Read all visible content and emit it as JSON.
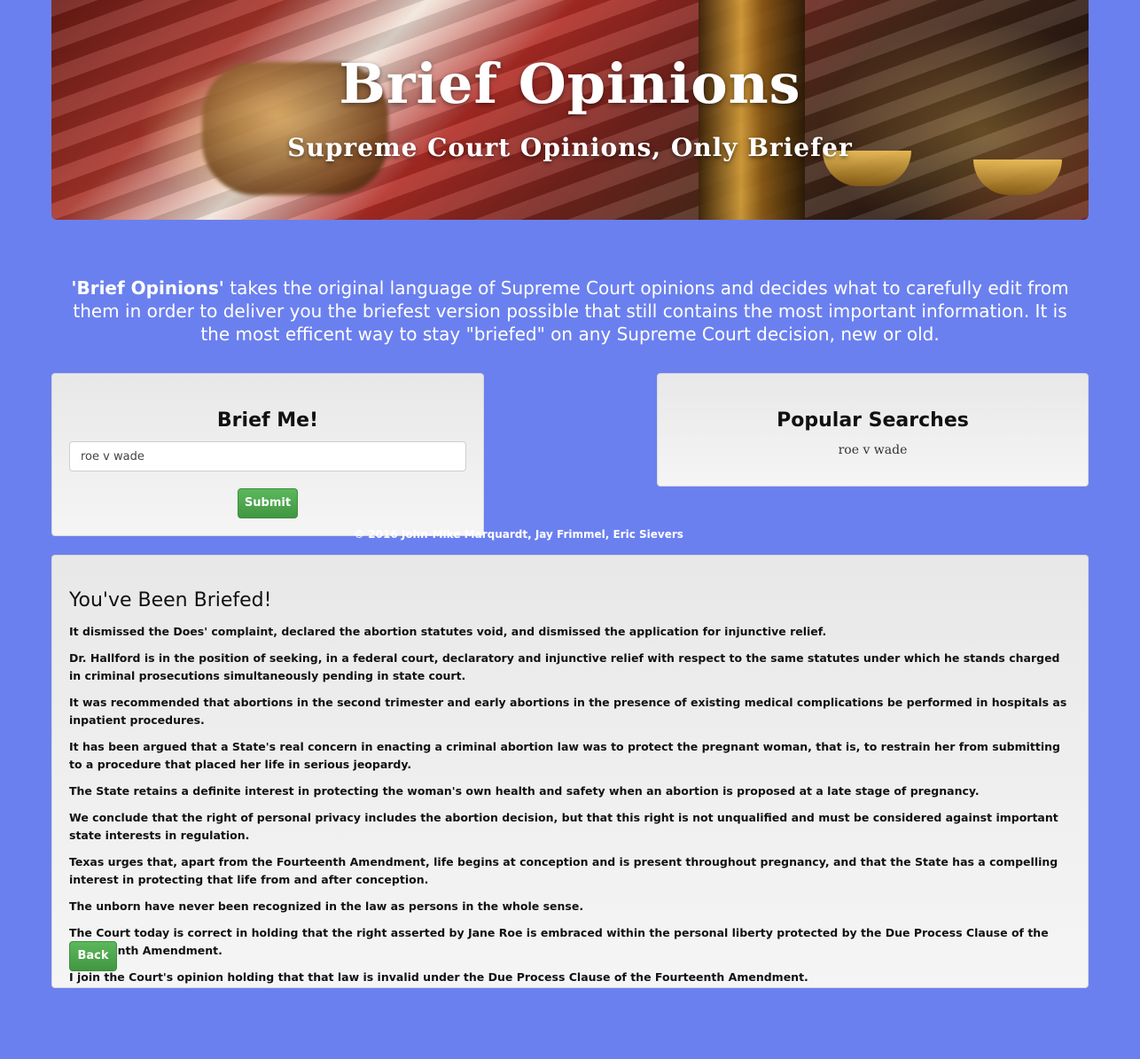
{
  "header": {
    "title": "Brief Opinions",
    "subtitle": "Supreme Court Opinions, Only Briefer"
  },
  "intro": {
    "brand": "'Brief Opinions'",
    "text": " takes the original language of Supreme Court opinions and decides what to carefully edit from them in order to deliver you the briefest version possible that still contains the most important information. It is the most efficent way to stay \"briefed\" on any Supreme Court decision, new or old."
  },
  "search": {
    "heading": "Brief Me!",
    "value": "roe v wade",
    "submit_label": "Submit"
  },
  "popular": {
    "heading": "Popular Searches",
    "items": [
      "roe v wade"
    ]
  },
  "footer": {
    "text": "© 2016 John-Mike Marquardt, Jay Frimmel, Eric Sievers"
  },
  "results": {
    "heading": "You've Been Briefed!",
    "sentences": [
      "It dismissed the Does' complaint, declared the abortion statutes void, and dismissed the application for injunctive relief.",
      "Dr. Hallford is in the position of seeking, in a federal court, declaratory and injunctive relief with respect to the same statutes under which he stands charged in criminal prosecutions simultaneously pending in state court.",
      "It was recommended that abortions in the second trimester and early abortions in the presence of existing medical complications be performed in hospitals as inpatient procedures.",
      "It has been argued that a State's real concern in enacting a criminal abortion law was to protect the pregnant woman, that is, to restrain her from submitting to a procedure that placed her life in serious jeopardy.",
      "The State retains a definite interest in protecting the woman's own health and safety when an abortion is proposed at a late stage of pregnancy.",
      "We conclude that the right of personal privacy includes the abortion decision, but that this right is not unqualified and must be considered against important state interests in regulation.",
      "Texas urges that, apart from the Fourteenth Amendment, life begins at conception and is present throughout pregnancy, and that the State has a compelling interest in protecting that life from and after conception.",
      "The unborn have never been recognized in the law as persons in the whole sense.",
      "The Court today is correct in holding that the right asserted by Jane Roe is embraced within the personal liberty protected by the Due Process Clause of the Fourteenth Amendment.",
      "I join the Court's opinion holding that that law is invalid under the Due Process Clause of the Fourteenth Amendment."
    ],
    "back_label": "Back"
  },
  "colors": {
    "background": "#6b80ef",
    "button": "#5cb85c"
  }
}
